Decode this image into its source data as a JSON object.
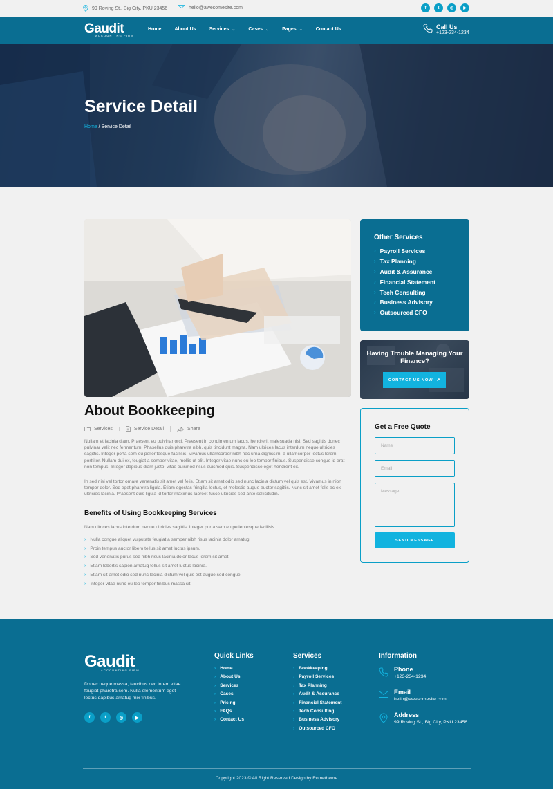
{
  "topbar": {
    "address": "99 Roving St., Big City, PKU 23456",
    "email": "hello@awesomesite.com",
    "socials": [
      "facebook-icon",
      "twitter-icon",
      "instagram-icon",
      "youtube-icon"
    ]
  },
  "brand": {
    "name": "Gaudit",
    "tagline": "Accounting Firm"
  },
  "nav": {
    "items": [
      {
        "label": "Home",
        "dropdown": false
      },
      {
        "label": "About Us",
        "dropdown": false
      },
      {
        "label": "Services",
        "dropdown": true
      },
      {
        "label": "Cases",
        "dropdown": true
      },
      {
        "label": "Pages",
        "dropdown": true
      },
      {
        "label": "Contact Us",
        "dropdown": false
      }
    ],
    "call_label": "Call Us",
    "call_number": "+123-234-1234"
  },
  "hero": {
    "title": "Service Detail",
    "breadcrumb_home": "Home",
    "breadcrumb_sep": " / ",
    "breadcrumb_current": "Service Detail"
  },
  "article": {
    "title": "About Bookkeeping",
    "meta": [
      {
        "icon": "folder-icon",
        "label": "Services"
      },
      {
        "icon": "document-icon",
        "label": "Service Detail"
      },
      {
        "icon": "share-icon",
        "label": "Share"
      }
    ],
    "para1": "Nullam et lacinia diam. Praesent eu pulvinar orci. Praesent in condimentum lacus, hendrerit malesuada nisi. Sed sagittis donec pulvinar velit nec fermentum. Phasellus quis pharetra nibh, quis tincidunt magna. Nam ultrices lacus interdum neque ultricies sagittis. Integer porta sem eu pellentesque facilisis. Vivamus ullamcorper nibh nec urna dignissim, a ullamcorper lectus  lorem porttitor. Nullam dui ex, feugiat a semper vitae, mollis ut elit. Integer vitae nunc eu leo tempor finibus. Suspendisse congue id erat non tempus. Integer dapibus diam justo, vitae euismod risus euismod quis. Suspendisse eget hendrerit ex.",
    "para2": "In sed nisi vel tortor ornare venenatis sit amet vel felis. Etiam sit amet odio sed nunc lacinia dictum vel quis est. Vivamus in nion tempor dolor. Sed eget pharetra ligula. Etiam egestas fringilla lectus, et molestie augue auctor sagittis. Nunc sit amet felis ac ex ultricies lacinia. Praesent quis ligula id tortor maximus laoreet fusce ultricies sed ante sollicitudin.",
    "benefits_title": "Benefits of Using Bookkeeping Services",
    "benefits_intro": "Nam ultrices lacus interdum neque ultricies sagittis. Integer porta sem eu pellentesque facilisis.",
    "benefits": [
      "Nulla congue aliquet vulputate feugiat a semper nibh risus lacinia dolor amatug.",
      "Proin tempus auctor libero tellus sit amet luctus ipsum.",
      "Sed venenatis purus sed nibh risus lacinia dolor lacus lorem sit amet.",
      "Etiam lobortis sapien amatug tellus sit amet luctus lacinia.",
      "Etiam sit amet odio sed nunc lacinia dictum vel quis est augue sed congue.",
      "Integer vitae nunc eu leo tempor finibus massa sit."
    ]
  },
  "sidebar": {
    "other_title": "Other Services",
    "other_items": [
      "Payroll Services",
      "Tax Planning",
      "Audit & Assurance",
      "Financial Statement",
      "Tech Consulting",
      "Business Advisory",
      "Outsourced CFO"
    ],
    "cta_text": "Having Trouble Managing Your Finance?",
    "cta_button": "CONTACT US NOW",
    "quote_title": "Get a Free Quote",
    "name_placeholder": "Name",
    "email_placeholder": "Email",
    "message_placeholder": "Message",
    "send_button": "SEND MESSAGE"
  },
  "footer": {
    "description": "Donec neque massa, faucibus nec lorem vitae feugiat pharetra sem. Nulla elementum eget lectus dapibus amatug mix finibus.",
    "quick_title": "Quick Links",
    "quick_links": [
      "Home",
      "About Us",
      "Services",
      "Cases",
      "Pricing",
      "FAQs",
      "Contact Us"
    ],
    "services_title": "Services",
    "services": [
      "Bookkeeping",
      "Payroll Services",
      "Tax Planning",
      "Audit & Assurance",
      "Financial Statement",
      "Tech Consulting",
      "Business Advisory",
      "Outsourced CFO"
    ],
    "info_title": "Information",
    "phone_label": "Phone",
    "phone": "+123-234-1234",
    "email_label": "Email",
    "email": "hello@awesomesite.com",
    "address_label": "Address",
    "address": "99 Roving St., Big City, PKU 23456",
    "copyright": "Copyright 2023 © All Right Reserved Design by Rometheme"
  },
  "colors": {
    "primary": "#0a6e92",
    "accent": "#12b3df",
    "background": "#f1f1f1"
  }
}
